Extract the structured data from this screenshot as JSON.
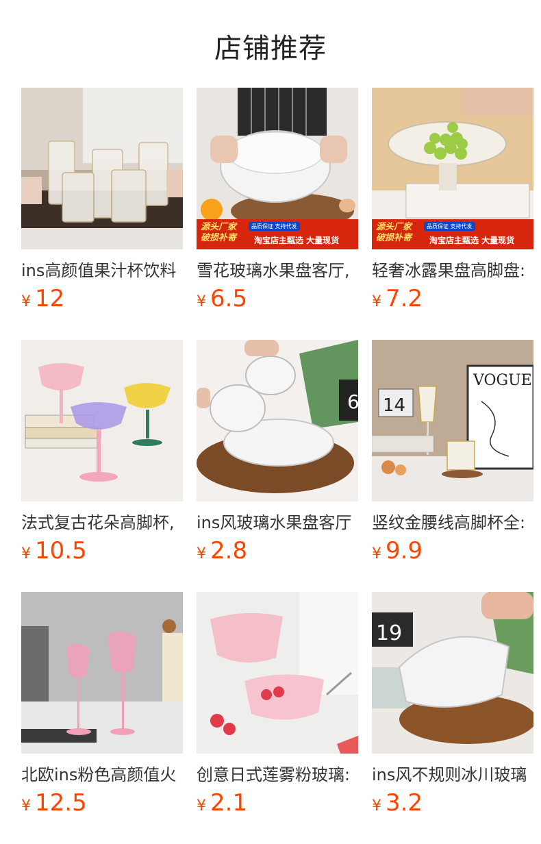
{
  "header": {
    "title": "店铺推荐"
  },
  "banner": {
    "left": "源头厂家\n破损补寄",
    "badge": "品质保证 支持代发",
    "right": "淘宝店主甄选 大量现货"
  },
  "products": [
    {
      "name": "ins高颜值果汁杯饮料",
      "currency": "¥",
      "price": "12",
      "image": "striped-glass-cups-on-wood-tray",
      "banner": false
    },
    {
      "name": "雪花玻璃水果盘客厅,",
      "currency": "¥",
      "price": "6.5",
      "image": "clear-glass-fruit-bowl-held",
      "banner": true
    },
    {
      "name": "轻奢冰露果盘高脚盘:",
      "currency": "¥",
      "price": "7.2",
      "image": "footed-glass-bowl-with-grapes",
      "banner": true
    },
    {
      "name": "法式复古花朵高脚杯,",
      "currency": "¥",
      "price": "10.5",
      "image": "colored-flower-coupe-glasses",
      "banner": false
    },
    {
      "name": "ins风玻璃水果盘客厅",
      "currency": "¥",
      "price": "2.8",
      "image": "glass-plates-on-wood-board",
      "banner": false
    },
    {
      "name": "竖纹金腰线高脚杯全:",
      "currency": "¥",
      "price": "9.9",
      "image": "gold-rim-goblet-and-vogue-frame",
      "banner": false
    },
    {
      "name": "北欧ins粉色高颜值火",
      "currency": "¥",
      "price": "12.5",
      "image": "pink-wine-glasses",
      "banner": false
    },
    {
      "name": "创意日式莲雾粉玻璃:",
      "currency": "¥",
      "price": "2.1",
      "image": "pink-frosted-glass-bowls",
      "banner": false
    },
    {
      "name": "ins风不规则冰川玻璃",
      "currency": "¥",
      "price": "3.2",
      "image": "glacier-glass-bowl-on-board",
      "banner": false
    }
  ]
}
